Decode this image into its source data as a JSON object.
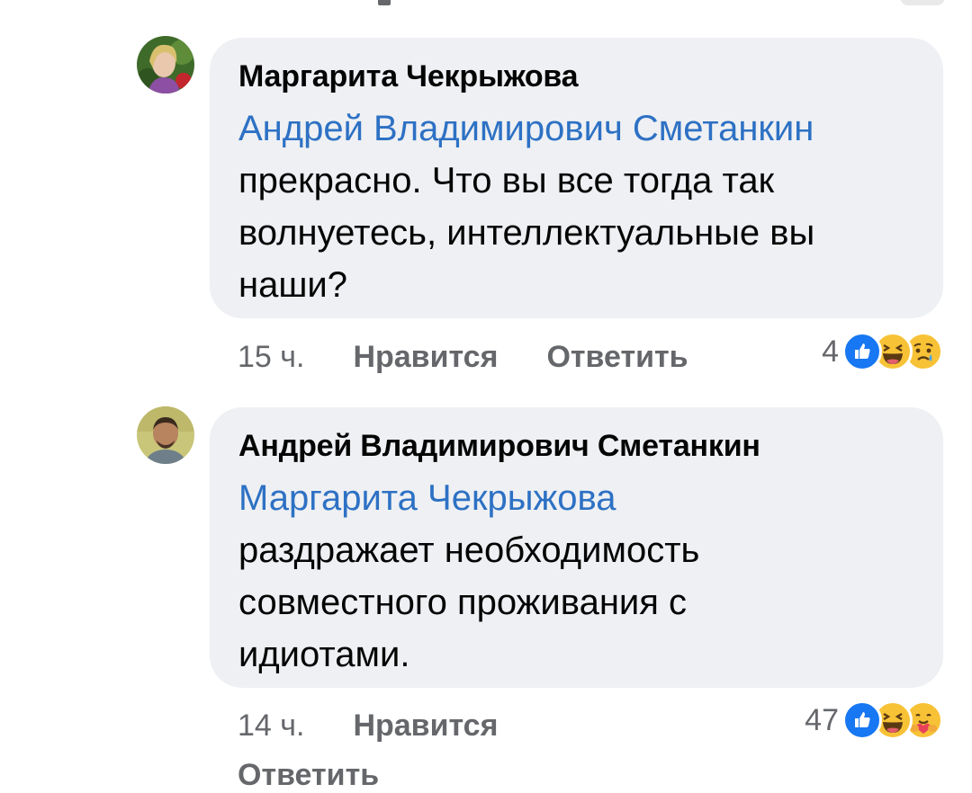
{
  "comments": [
    {
      "author": "Маргарита Чекрыжова",
      "mention": "Андрей Владимирович Сметанкин",
      "text_lines": [
        "прекрасно. Что вы все тогда так",
        "волнуетесь, интеллектуальные вы",
        "наши?"
      ],
      "time": "15 ч.",
      "like_label": "Нравится",
      "reply_label": "Ответить",
      "reaction_count": "4",
      "reactions": [
        "like-icon",
        "haha-icon",
        "sad-icon"
      ]
    },
    {
      "author": "Андрей Владимирович Сметанкин",
      "mention": "Маргарита Чекрыжова",
      "text_lines": [
        "раздражает необходимость",
        "совместного проживания с",
        "идиотами."
      ],
      "time": "14 ч.",
      "like_label": "Нравится",
      "reply_label": "Ответить",
      "reaction_count": "47",
      "reactions": [
        "like-icon",
        "haha-icon",
        "care-icon"
      ]
    }
  ],
  "colors": {
    "bubble_bg": "#eef0f3",
    "mention": "#2d71c4",
    "meta": "#65676b",
    "like_blue": "#1877f2",
    "emoji_yellow": "#f7c236"
  }
}
